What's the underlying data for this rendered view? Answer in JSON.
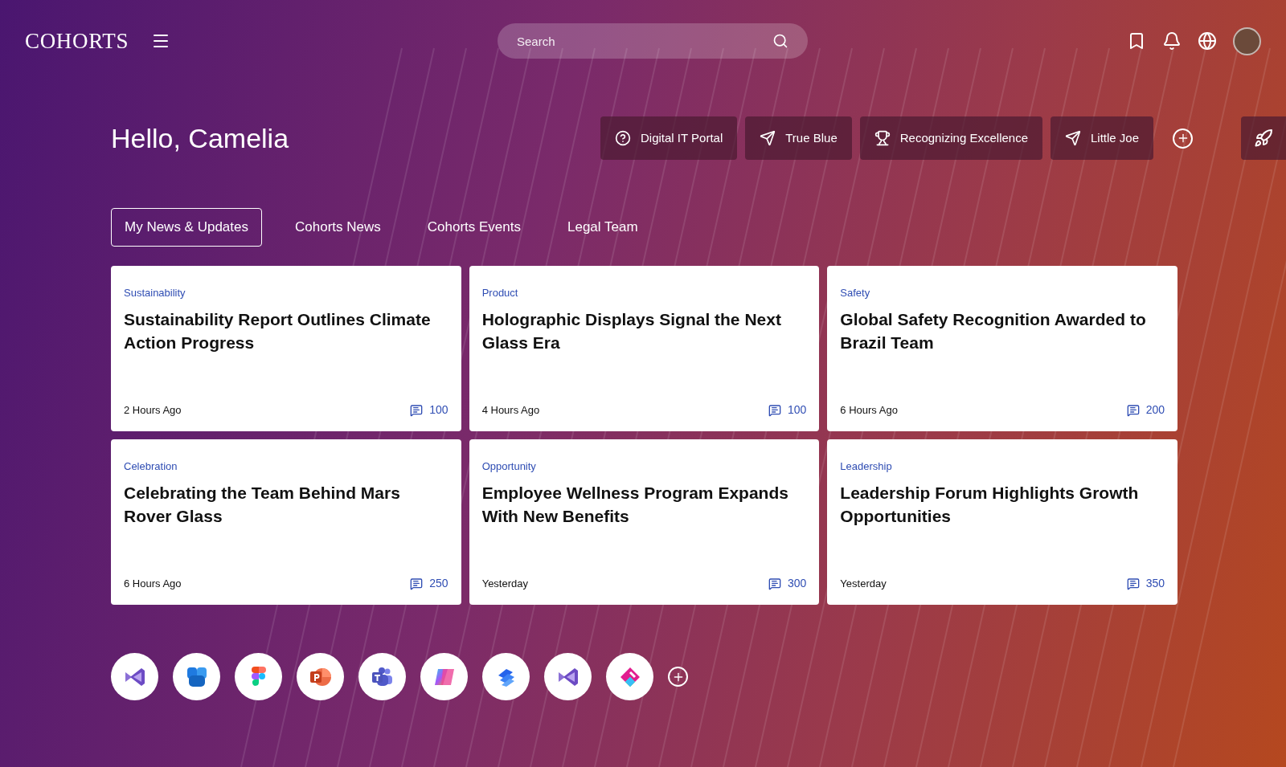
{
  "header": {
    "logo": "COHORTS",
    "search": {
      "placeholder": "Search"
    }
  },
  "greeting": "Hello, Camelia",
  "quick_links": [
    {
      "label": "Digital IT Portal",
      "kind": "help"
    },
    {
      "label": "True Blue",
      "kind": "send"
    },
    {
      "label": "Recognizing Excellence",
      "kind": "trophy"
    },
    {
      "label": "Little Joe",
      "kind": "send"
    }
  ],
  "tabs": [
    {
      "label": "My News & Updates",
      "selected": true
    },
    {
      "label": "Cohorts News",
      "selected": false
    },
    {
      "label": "Cohorts Events",
      "selected": false
    },
    {
      "label": "Legal Team",
      "selected": false
    }
  ],
  "cards": [
    {
      "category": "Sustainability",
      "title": "Sustainability Report Outlines Climate Action Progress",
      "time": "2 Hours Ago",
      "comments": "100"
    },
    {
      "category": "Product",
      "title": "Holographic Displays Signal the Next Glass Era",
      "time": "4 Hours Ago",
      "comments": "100"
    },
    {
      "category": "Safety",
      "title": "Global Safety Recognition Awarded to Brazil Team",
      "time": "6 Hours Ago",
      "comments": "200"
    },
    {
      "category": "Celebration",
      "title": "Celebrating the Team Behind Mars Rover Glass",
      "time": "6 Hours Ago",
      "comments": "250"
    },
    {
      "category": "Opportunity",
      "title": "Employee Wellness Program Expands With New Benefits",
      "time": "Yesterday",
      "comments": "300"
    },
    {
      "category": "Leadership",
      "title": "Leadership Forum Highlights Growth Opportunities",
      "time": "Yesterday",
      "comments": "350"
    }
  ],
  "apps": [
    {
      "kind": "studio"
    },
    {
      "kind": "blocks"
    },
    {
      "kind": "design"
    },
    {
      "kind": "slides"
    },
    {
      "kind": "chat"
    },
    {
      "kind": "copilot"
    },
    {
      "kind": "layers"
    },
    {
      "kind": "studio"
    },
    {
      "kind": "loop"
    }
  ]
}
